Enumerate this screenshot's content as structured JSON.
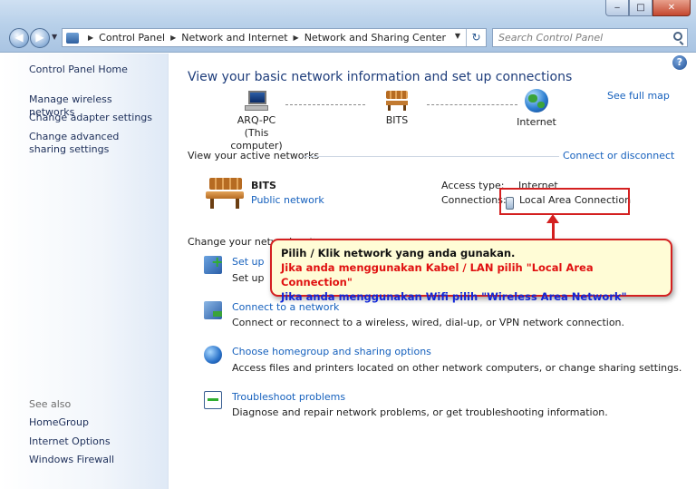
{
  "window": {
    "controls": {
      "minimize": "‒",
      "maximize": "□",
      "close": "✕"
    }
  },
  "address": {
    "breadcrumbs": [
      "Control Panel",
      "Network and Internet",
      "Network and Sharing Center"
    ],
    "search_placeholder": "Search Control Panel"
  },
  "sidebar": {
    "home": "Control Panel Home",
    "links": [
      "Manage wireless networks",
      "Change adapter settings",
      "Change advanced sharing settings"
    ],
    "see_also_label": "See also",
    "see_also": [
      "HomeGroup",
      "Internet Options",
      "Windows Firewall"
    ]
  },
  "main": {
    "title": "View your basic network information and set up connections",
    "see_full_map": "See full map",
    "map": {
      "computer_name": "ARQ-PC",
      "computer_sub": "(This computer)",
      "network_name": "BITS",
      "internet": "Internet"
    },
    "active_label": "View your active networks",
    "connect_disconnect": "Connect or disconnect",
    "active_network": {
      "name": "BITS",
      "type": "Public network",
      "access_type_label": "Access type:",
      "access_type_value": "Internet",
      "connections_label": "Connections:",
      "connections_value": "Local Area Connection"
    },
    "change_label": "Change your network settings",
    "tasks": [
      {
        "title": "Set up a new connection or network",
        "desc": "Set up a wireless, broadband, dial-up, ad hoc, or VPN connection; or set up a router or access point."
      },
      {
        "title": "Connect to a network",
        "desc": "Connect or reconnect to a wireless, wired, dial-up, or VPN network connection."
      },
      {
        "title": "Choose homegroup and sharing options",
        "desc": "Access files and printers located on other network computers, or change sharing settings."
      },
      {
        "title": "Troubleshoot problems",
        "desc": "Diagnose and repair network problems, or get troubleshooting information."
      }
    ]
  },
  "annotation": {
    "line1": "Pilih / Klik network yang anda gunakan.",
    "line2": "Jika anda menggunakan Kabel / LAN pilih \"Local Area Connection\"",
    "line3": "Jika anda menggunakan Wifi pilih \"Wireless Area Network\"",
    "colors": {
      "border": "#d42020",
      "line2": "#e01010",
      "line3": "#1026d8",
      "background": "#fffcd6"
    }
  }
}
